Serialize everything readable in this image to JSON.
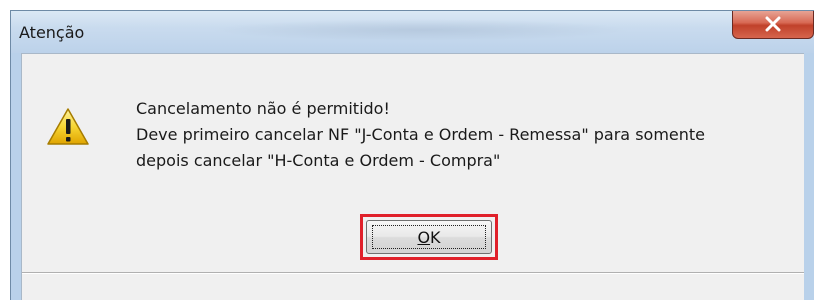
{
  "dialog": {
    "title": "Atenção",
    "message_lines": [
      "Cancelamento não é permitido!",
      "Deve primeiro cancelar NF \"J-Conta e Ordem - Remessa\" para somente",
      "depois cancelar \"H-Conta e Ordem - Compra\""
    ],
    "ok_label_first": "O",
    "ok_label_rest": "K",
    "icon": "warning-icon",
    "close_icon": "close-icon"
  },
  "colors": {
    "highlight": "#e0202a",
    "close_button": "#c0412a",
    "client_bg": "#f0f0f0",
    "frame_bg": "#b9d1ea"
  }
}
